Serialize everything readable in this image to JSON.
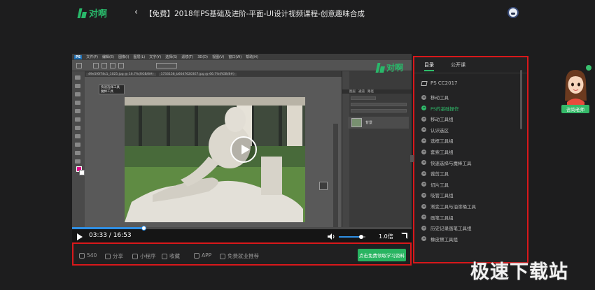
{
  "header": {
    "brand": "对啊",
    "back_icon": "chevron-left-icon",
    "title": "【免费】2018年PS基础及进阶-平面-UI设计视频课程-创意趣味合成"
  },
  "photoshop": {
    "badge": "PS",
    "menu": [
      "文件(F)",
      "编辑(E)",
      "图像(I)",
      "图层(L)",
      "文字(Y)",
      "选择(S)",
      "滤镜(T)",
      "3D(D)",
      "视图(V)",
      "窗口(W)",
      "帮助(H)"
    ],
    "doc_tabs": [
      "49e5f6f78c1_1025.jpg @ 16.7%(RGB/8#)",
      "1733158_b60476203E7.jpg @ 66.7%(RGB/8#)"
    ],
    "tool_flyout": [
      "快速选择工具",
      "魔棒工具"
    ],
    "panel_tabs": [
      "图层",
      "通道",
      "路径"
    ],
    "layer_name": "背景",
    "watermark": "对啊"
  },
  "player": {
    "time": "03:33 / 16:53",
    "progress": 0.21,
    "volume": 0.85,
    "speed": "1.0倍"
  },
  "actions": {
    "like_count": "540",
    "share": "分享",
    "mini_program": "小程序",
    "collect": "收藏",
    "app": "APP",
    "job_recommend": "免费就业推荐",
    "cta": "点击免费领取学习资料"
  },
  "catalog": {
    "tabs": [
      "目录",
      "公开课"
    ],
    "chapter": "PS CC2017",
    "items": [
      {
        "label": "移动工具",
        "active": false
      },
      {
        "label": "PS的基础操作",
        "active": true
      },
      {
        "label": "移动工具组",
        "active": false
      },
      {
        "label": "认识选区",
        "active": false
      },
      {
        "label": "选框工具组",
        "active": false
      },
      {
        "label": "套索工具组",
        "active": false
      },
      {
        "label": "快速选择与魔棒工具",
        "active": false
      },
      {
        "label": "裁剪工具",
        "active": false
      },
      {
        "label": "切片工具",
        "active": false
      },
      {
        "label": "吸管工具组",
        "active": false
      },
      {
        "label": "渐变工具与油漆桶工具",
        "active": false
      },
      {
        "label": "画笔工具组",
        "active": false
      },
      {
        "label": "历史记录画笔工具组",
        "active": false
      },
      {
        "label": "橡皮擦工具组",
        "active": false
      }
    ]
  },
  "advisor": {
    "label": "咨询老师"
  },
  "site_watermark": "极速下载站",
  "colors": {
    "accent_green": "#28b461",
    "highlight_red": "#d9181b",
    "progress_blue": "#2f8fe3"
  }
}
